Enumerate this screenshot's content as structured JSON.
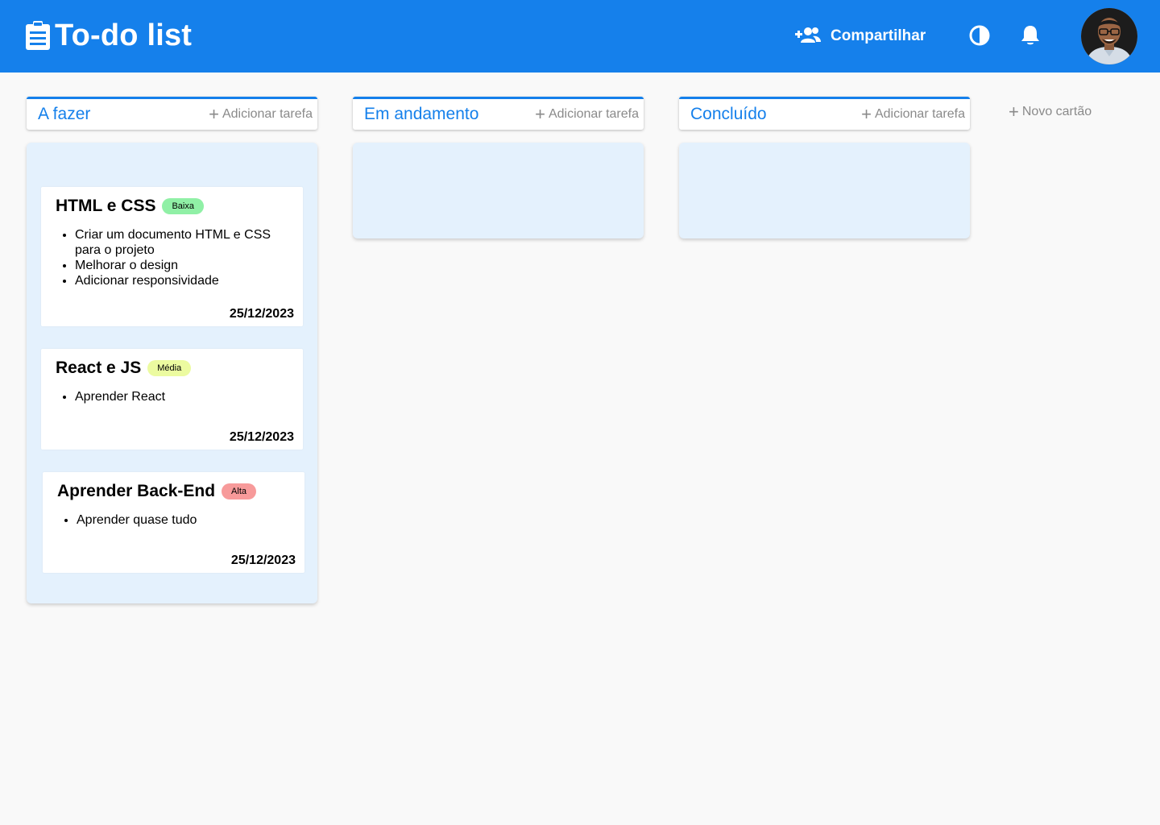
{
  "header": {
    "app_title": "To-do list",
    "share_label": "Compartilhar",
    "bg_color": "#1580eb",
    "icons": [
      "clipboard-icon",
      "add-users-icon",
      "contrast-icon",
      "bell-icon"
    ]
  },
  "columns": [
    {
      "title": "A fazer",
      "add_label": "Adicionar tarefa"
    },
    {
      "title": "Em andamento",
      "add_label": "Adicionar tarefa"
    },
    {
      "title": "Concluído",
      "add_label": "Adicionar tarefa"
    }
  ],
  "new_card_label": "Novo cartão",
  "cards": [
    {
      "title": "HTML e CSS",
      "priority": "Baixa",
      "priority_color": "#90f0a6",
      "items": [
        "Criar um documento HTML e CSS para o projeto",
        "Melhorar o design",
        "Adicionar responsividade"
      ],
      "date": "25/12/2023"
    },
    {
      "title": "React e JS",
      "priority": "Média",
      "priority_color": "#ecfba0",
      "items": [
        "Aprender React"
      ],
      "date": "25/12/2023"
    },
    {
      "title": "Aprender Back-End",
      "priority": "Alta",
      "priority_color": "#f79a9a",
      "items": [
        "Aprender quase tudo"
      ],
      "date": "25/12/2023"
    }
  ]
}
